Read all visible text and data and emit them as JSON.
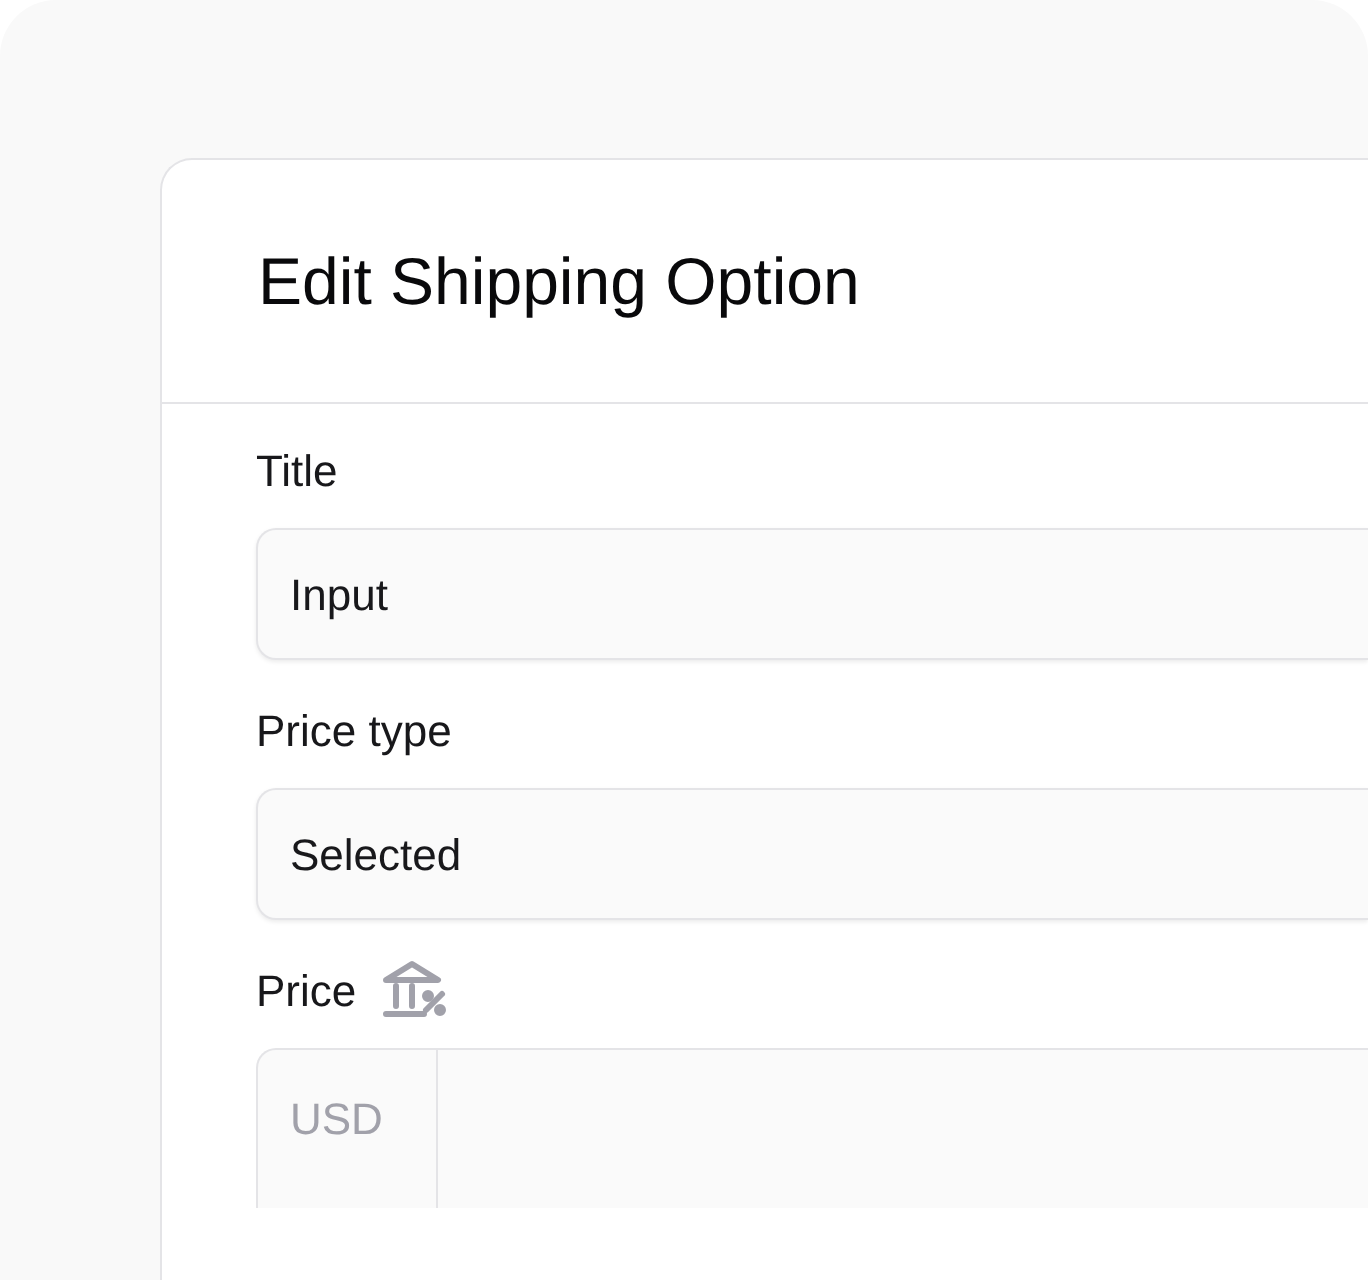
{
  "dialog": {
    "title": "Edit Shipping Option"
  },
  "fields": [
    {
      "kind": "text",
      "label": "Title",
      "value": "Input"
    },
    {
      "kind": "select",
      "label": "Price type",
      "value": "Selected"
    },
    {
      "kind": "currency",
      "label": "Price",
      "prefix": "USD"
    }
  ]
}
